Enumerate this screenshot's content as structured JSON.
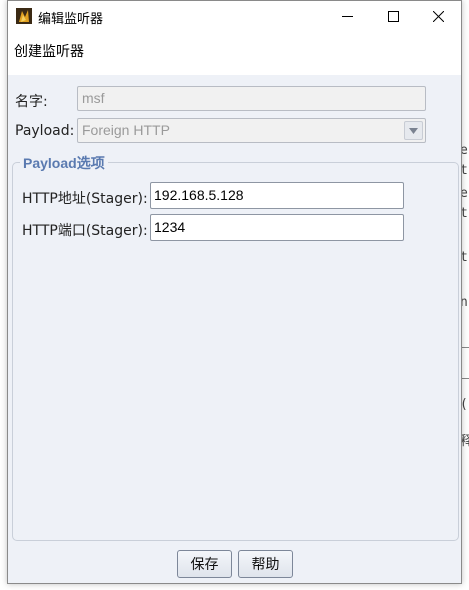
{
  "background_app": {
    "glyphs": [
      "e",
      "t",
      "e",
      "t",
      "t",
      "n",
      "(",
      "释"
    ]
  },
  "window": {
    "title": "编辑监听器",
    "icon": "app-logo-icon",
    "controls": {
      "minimize": "minimize-icon",
      "maximize": "maximize-icon",
      "close": "close-icon"
    }
  },
  "header": {
    "text": "创建监听器"
  },
  "form": {
    "name_label": "名字:",
    "name_value": "msf",
    "payload_label": "Payload:",
    "payload_value": "Foreign HTTP",
    "group_title": "Payload选项",
    "host_label": "HTTP地址(Stager):",
    "host_value": "192.168.5.128",
    "port_label": "HTTP端口(Stager):",
    "port_value": "1234"
  },
  "footer": {
    "save_label": "保存",
    "help_label": "帮助"
  },
  "colors": {
    "panel_bg": "#eef1f7",
    "group_title": "#5a7ab0"
  }
}
